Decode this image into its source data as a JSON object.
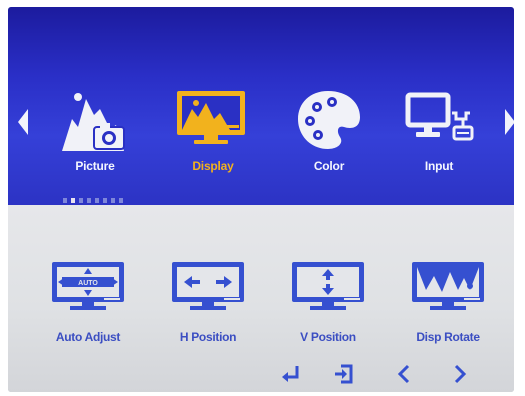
{
  "menu": {
    "categories": [
      {
        "label": "Picture",
        "icon": "picture-mountain-camera-icon",
        "selected": false
      },
      {
        "label": "Display",
        "icon": "display-monitor-icon",
        "selected": true
      },
      {
        "label": "Color",
        "icon": "color-palette-icon",
        "selected": false
      },
      {
        "label": "Input",
        "icon": "input-computer-icon",
        "selected": false
      }
    ],
    "page_indicator": {
      "total": 8,
      "current": 2
    }
  },
  "submenu": {
    "items": [
      {
        "label": "Auto Adjust",
        "icon": "auto-adjust-icon",
        "icon_text": "AUTO"
      },
      {
        "label": "H Position",
        "icon": "h-position-icon"
      },
      {
        "label": "V Position",
        "icon": "v-position-icon"
      },
      {
        "label": "Disp Rotate",
        "icon": "disp-rotate-icon"
      }
    ]
  },
  "nav": {
    "buttons": [
      "enter-icon",
      "exit-icon",
      "left-arrow-icon",
      "right-arrow-icon"
    ]
  },
  "colors": {
    "top_bg": "#2a30c4",
    "selected": "#f2b21d",
    "icon_blue": "#3550d0",
    "label_blue": "#3b4ec2"
  }
}
